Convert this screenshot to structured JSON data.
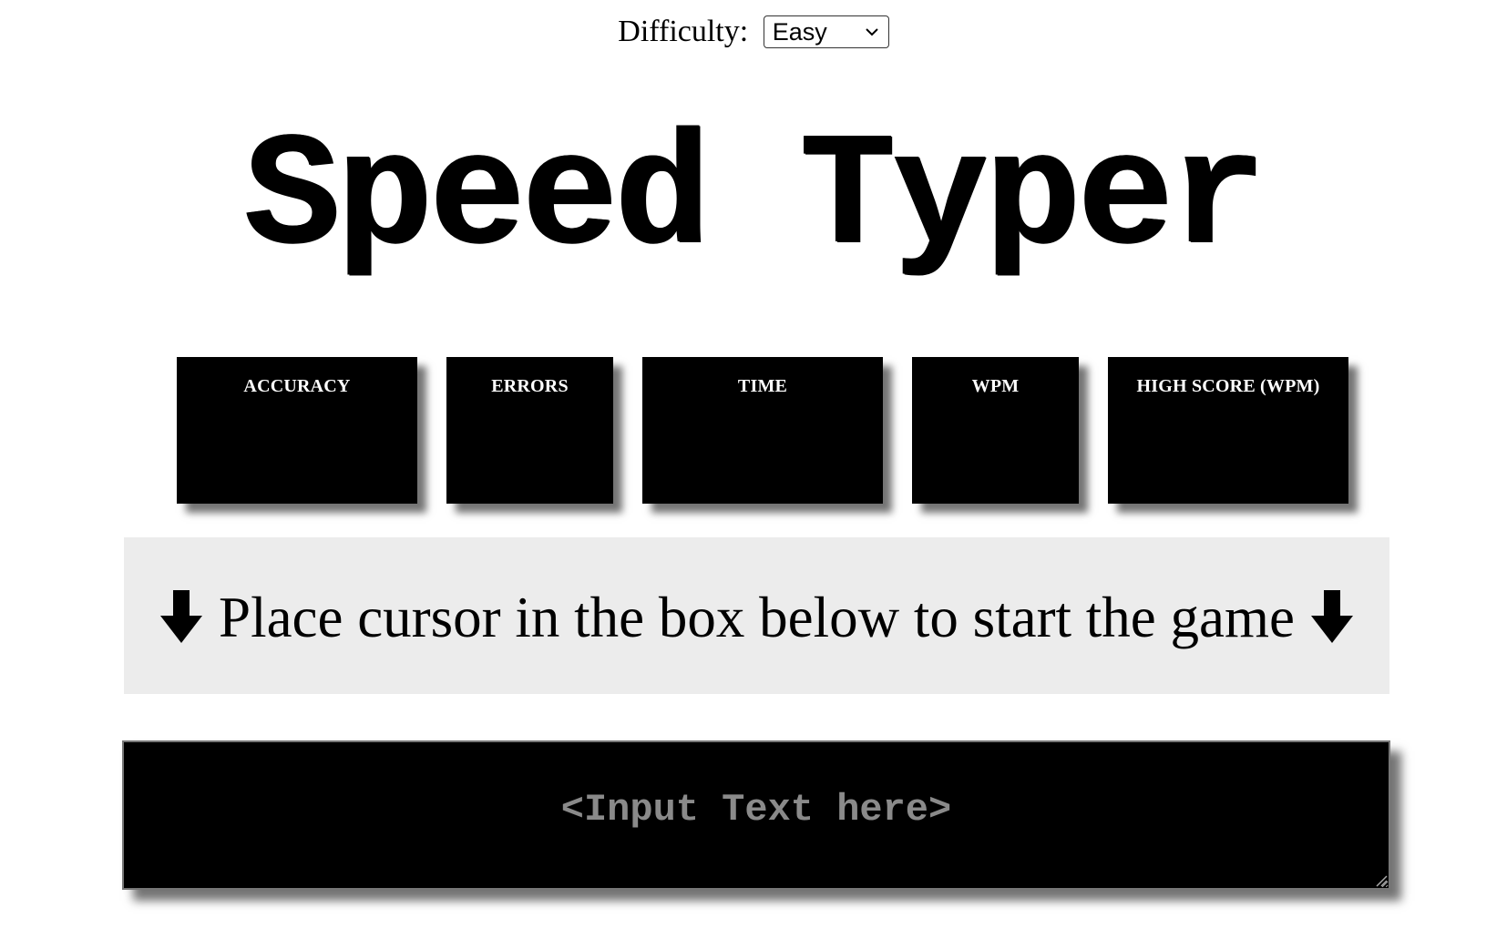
{
  "difficulty": {
    "label": "Difficulty:",
    "selected": "Easy",
    "options": [
      "Easy"
    ],
    "chevron_icon": "chevron-down-icon"
  },
  "title": "Speed Typer",
  "stats": [
    {
      "key": "accuracy",
      "label": "ACCURACY",
      "value": ""
    },
    {
      "key": "errors",
      "label": "ERRORS",
      "value": ""
    },
    {
      "key": "time",
      "label": "TIME",
      "value": ""
    },
    {
      "key": "wpm",
      "label": "WPM",
      "value": ""
    },
    {
      "key": "high-score",
      "label": "HIGH SCORE (WPM)",
      "value": ""
    }
  ],
  "instruction": {
    "text": "Place cursor in the box below to start the game",
    "left_icon": "arrow-down-icon",
    "right_icon": "arrow-down-icon"
  },
  "input": {
    "placeholder": "<Input Text here>",
    "value": ""
  },
  "colors": {
    "stat_background": "#000000",
    "stat_text": "#ffffff",
    "banner_background": "#ececec",
    "input_background": "#000000",
    "placeholder": "#8a8a8a"
  }
}
